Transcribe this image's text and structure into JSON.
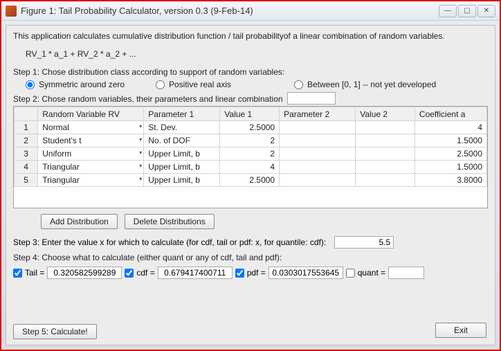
{
  "window": {
    "title": "Figure 1: Tail Probability Calculator, version 0.3 (9-Feb-14)",
    "minimize": "—",
    "maximize": "▢",
    "close": "✕"
  },
  "intro": "This application calculates cumulative distribution function / tail probabilityof a linear combination of random variables.",
  "formula": "RV_1 * a_1 + RV_2 * a_2 + ...",
  "step1": "Step 1: Chose distribution class according to support of random variables:",
  "radios": {
    "r1": "Symmetric around zero",
    "r2": "Positive real axis",
    "r3": "Between [0, 1] -- not yet developed"
  },
  "step2": "Step 2: Chose random variables, their parameters and linear combination",
  "table": {
    "headers": {
      "rownum": "",
      "rv": "Random Variable RV",
      "p1": "Parameter 1",
      "v1": "Value 1",
      "p2": "Parameter 2",
      "v2": "Value 2",
      "ca": "Coefficient a"
    },
    "rows": [
      {
        "n": "1",
        "rv": "Normal",
        "p1": "St. Dev.",
        "v1": "2.5000",
        "p2": "",
        "v2": "",
        "ca": "4"
      },
      {
        "n": "2",
        "rv": "Student's t",
        "p1": "No. of DOF",
        "v1": "2",
        "p2": "",
        "v2": "",
        "ca": "1.5000"
      },
      {
        "n": "3",
        "rv": "Uniform",
        "p1": "Upper Limit, b",
        "v1": "2",
        "p2": "",
        "v2": "",
        "ca": "2.5000"
      },
      {
        "n": "4",
        "rv": "Triangular",
        "p1": "Upper Limit, b",
        "v1": "4",
        "p2": "",
        "v2": "",
        "ca": "1.5000"
      },
      {
        "n": "5",
        "rv": "Triangular",
        "p1": "Upper Limit, b",
        "v1": "2.5000",
        "p2": "",
        "v2": "",
        "ca": "3.8000"
      }
    ]
  },
  "buttons": {
    "add": "Add Distribution",
    "del": "Delete Distributions",
    "calc": "Step 5: Calculate!",
    "exit": "Exit"
  },
  "step3": {
    "label": "Step 3: Enter the value x for which to calculate (for cdf, tail or pdf: x, for quantile: cdf):",
    "x": "5.5"
  },
  "step4": {
    "label": "Step 4: Choose what to calculate (either quant or any of cdf, tail and pdf):",
    "tail_lbl": "Tail =",
    "tail_val": "0.320582599289",
    "cdf_lbl": "cdf =",
    "cdf_val": "0.679417400711",
    "pdf_lbl": "pdf =",
    "pdf_val": "0.0303017553645",
    "quant_lbl": "quant =",
    "quant_val": ""
  }
}
